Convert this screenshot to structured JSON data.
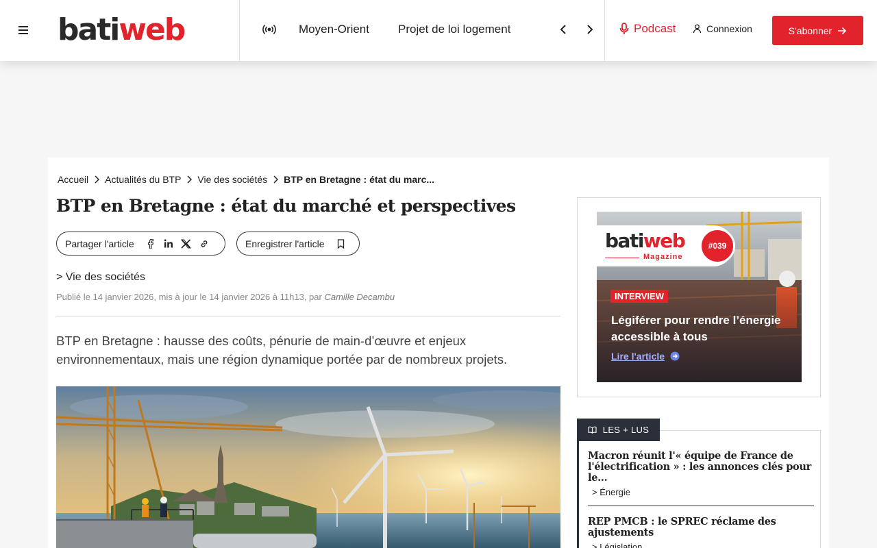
{
  "header": {
    "logo": {
      "part1": "bati",
      "part2": "web"
    },
    "nav": [
      "Moyen-Orient",
      "Projet de loi logement"
    ],
    "podcast": "Podcast",
    "login": "Connexion",
    "subscribe": "S'abonner"
  },
  "breadcrumb": [
    "Accueil",
    "Actualités du BTP",
    "Vie des sociétés",
    "BTP en Bretagne : état du marc..."
  ],
  "article": {
    "title": "BTP en Bretagne : état du marché et perspectives",
    "share_label": "Partager l'article",
    "save_label": "Enregistrer l'article",
    "category": "> Vie des sociétés",
    "meta_prefix": "Publié le 14 janvier 2026, mis à jour le 14 janvier 2026 à 11h13, par ",
    "author": "Camille Decambu",
    "lead": "BTP en Bretagne : hausse des coûts, pénurie de main-d’œuvre et enjeux environnementaux, mais une région dynamique portée par de nombreux projets."
  },
  "ad": {
    "logo_part1": "bati",
    "logo_part2": "web",
    "magazine": "Magazine",
    "issue": "#039",
    "tag": "INTERVIEW",
    "headline": "Légiférer pour rendre l’énergie accessible à tous",
    "link": "Lire l'article"
  },
  "popular": {
    "tab": "LES + LUS",
    "items": [
      {
        "title": "Macron réunit l'« équipe de France de l'électrification » : les annonces clés pour le...",
        "category": "> Énergie"
      },
      {
        "title": "REP PMCB : le SPREC réclame des ajustements",
        "category": "> Législation"
      }
    ]
  },
  "colors": {
    "brand_red": "#e3232c",
    "dark": "#2b2f3a"
  }
}
